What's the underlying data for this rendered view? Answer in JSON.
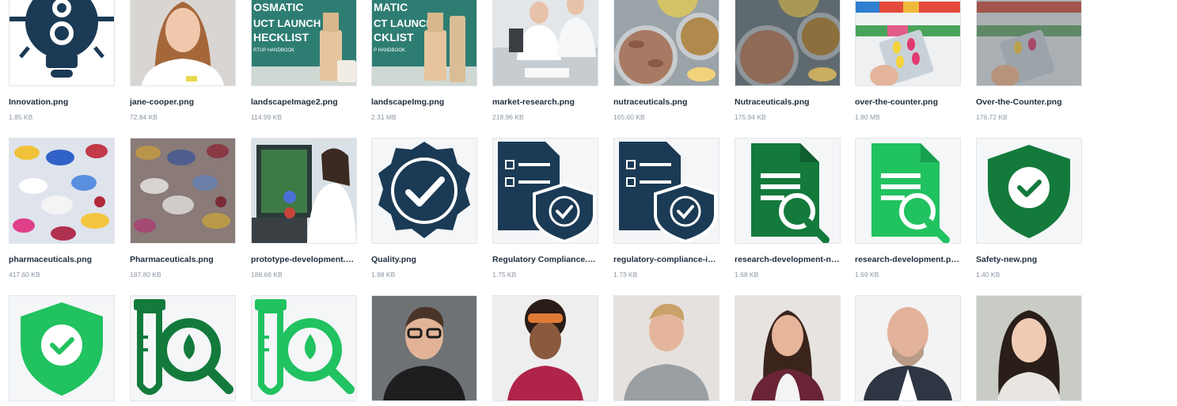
{
  "colors": {
    "navy": "#1b3a55",
    "dark_green": "#137a3c",
    "bright_green": "#21c260",
    "teal": "#2e7d73",
    "tile_border": "#e3e6ea",
    "name_text": "#1f2d3d",
    "size_text": "#8a96a3"
  },
  "files": [
    {
      "name": "Innovation.png",
      "size": "1.85 KB",
      "icon": "lightbulb-icon"
    },
    {
      "name": "jane-cooper.png",
      "size": "72.84 KB",
      "icon": "portrait-photo"
    },
    {
      "name": "landscapeImage2.png",
      "size": "114.99 KB",
      "icon": "cosmetic-checklist-photo",
      "image_text": "OSMATIC UCT LAUNCH HECKLIST RTUP HANDBOOK"
    },
    {
      "name": "landscapeImg.png",
      "size": "2.31 MB",
      "icon": "cosmetic-checklist-photo",
      "image_text": "MATIC CT LAUNCH CKLIST P HANDBOOK"
    },
    {
      "name": "market-research.png",
      "size": "218.96 KB",
      "icon": "lab-photo"
    },
    {
      "name": "nutraceuticals.png",
      "size": "165.60 KB",
      "icon": "capsules-photo"
    },
    {
      "name": "Nutraceuticals.png",
      "size": "175.94 KB",
      "icon": "capsules-photo"
    },
    {
      "name": "over-the-counter.png",
      "size": "1.80 MB",
      "icon": "pharmacy-shelf-photo"
    },
    {
      "name": "Over-the-Counter.png",
      "size": "176.72 KB",
      "icon": "pharmacy-shelf-photo"
    },
    {
      "name": "pharmaceuticals.png",
      "size": "417.60 KB",
      "icon": "pills-photo"
    },
    {
      "name": "Pharmaceuticals.png",
      "size": "187.80 KB",
      "icon": "pills-photo"
    },
    {
      "name": "prototype-development.png",
      "size": "188.68 KB",
      "icon": "scientist-photo"
    },
    {
      "name": "Quality.png",
      "size": "1.98 KB",
      "icon": "quality-badge-icon"
    },
    {
      "name": "Regulatory Compliance.png",
      "size": "1.75 KB",
      "icon": "document-shield-icon"
    },
    {
      "name": "regulatory-compliance-icon.png",
      "size": "1.73 KB",
      "icon": "document-shield-icon"
    },
    {
      "name": "research-development-new.png",
      "size": "1.68 KB",
      "icon": "document-search-icon"
    },
    {
      "name": "research-development.png",
      "size": "1.69 KB",
      "icon": "document-search-icon"
    },
    {
      "name": "Safety-new.png",
      "size": "1.40 KB",
      "icon": "shield-check-icon"
    },
    {
      "name": "",
      "size": "",
      "icon": "shield-check-icon"
    },
    {
      "name": "",
      "size": "",
      "icon": "test-tube-search-icon"
    },
    {
      "name": "",
      "size": "",
      "icon": "test-tube-search-icon"
    },
    {
      "name": "",
      "size": "",
      "icon": "portrait-photo"
    },
    {
      "name": "",
      "size": "",
      "icon": "portrait-photo"
    },
    {
      "name": "",
      "size": "",
      "icon": "portrait-photo"
    },
    {
      "name": "",
      "size": "",
      "icon": "portrait-photo"
    },
    {
      "name": "",
      "size": "",
      "icon": "portrait-photo"
    },
    {
      "name": "",
      "size": "",
      "icon": "portrait-photo"
    }
  ]
}
